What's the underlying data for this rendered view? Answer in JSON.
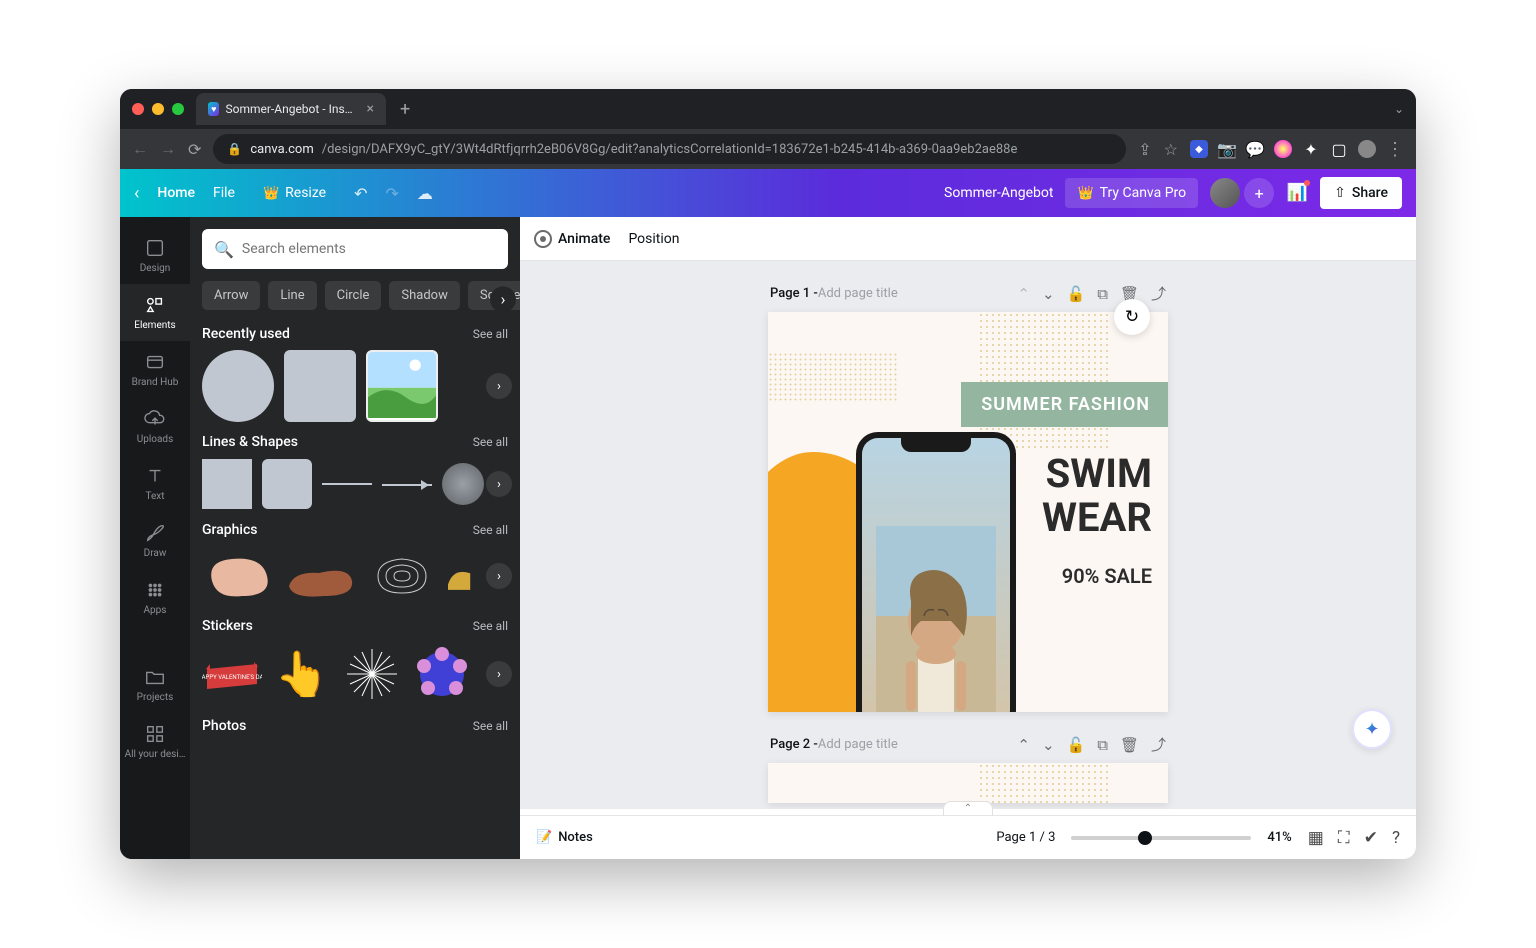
{
  "browser": {
    "tab_title": "Sommer-Angebot - Instagram",
    "url_host": "canva.com",
    "url_path": "/design/DAFX9yC_gtY/3Wt4dRtfjqrrh2eB06V8Gg/edit?analyticsCorrelationId=183672e1-b245-414b-a369-0aa9eb2ae88e"
  },
  "canvabar": {
    "home": "Home",
    "file": "File",
    "resize": "Resize",
    "doc_title": "Sommer-Angebot",
    "try_pro": "Try Canva Pro",
    "share": "Share"
  },
  "rail": {
    "design": "Design",
    "elements": "Elements",
    "brandhub": "Brand Hub",
    "uploads": "Uploads",
    "text": "Text",
    "draw": "Draw",
    "apps": "Apps",
    "projects": "Projects",
    "allyourdesigns": "All your desi…"
  },
  "panel": {
    "search_placeholder": "Search elements",
    "tags": [
      "Arrow",
      "Line",
      "Circle",
      "Shadow",
      "Square"
    ],
    "see_all": "See all",
    "sections": {
      "recently": "Recently used",
      "lines": "Lines & Shapes",
      "graphics": "Graphics",
      "stickers": "Stickers",
      "photos": "Photos"
    }
  },
  "canvas": {
    "animate": "Animate",
    "position": "Position",
    "page1_label": "Page 1 - ",
    "page1_hint": "Add page title",
    "page2_label": "Page 2 - ",
    "page2_hint": "Add page title",
    "design": {
      "summer_fashion": "SUMMER FASHION",
      "swim": "SWIM",
      "wear": "WEAR",
      "sale": "90% SALE"
    }
  },
  "bottombar": {
    "notes": "Notes",
    "page_counter": "Page 1 / 3",
    "zoom": "41%"
  }
}
